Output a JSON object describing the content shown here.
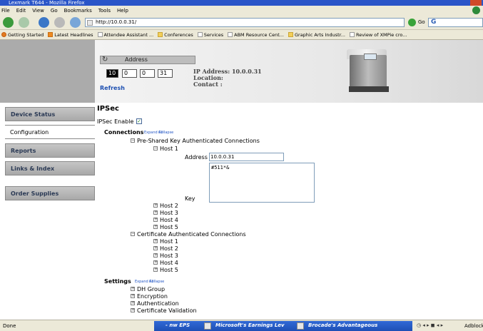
{
  "window": {
    "title": "Lexmark T644 - Mozilla Firefox"
  },
  "menu": [
    "File",
    "Edit",
    "View",
    "Go",
    "Bookmarks",
    "Tools",
    "Help"
  ],
  "toolbar": {
    "url": "http://10.0.0.31/",
    "go_label": "Go"
  },
  "bookmarks": [
    "Getting Started",
    "Latest Headlines",
    "Attendee Assistant ...",
    "Conferences",
    "Services",
    "ABM Resource Cent...",
    "Graphic Arts Industr...",
    "Review of XMPie cro..."
  ],
  "header": {
    "address_label": "Address",
    "ip_octets": [
      "10",
      "0",
      "0",
      "31"
    ],
    "refresh_label": "Refresh",
    "ip_address_line": "IP Address: 10.0.0.31",
    "location_line": "Location:",
    "contact_line": "Contact :"
  },
  "nav": [
    {
      "label": "Device Status"
    },
    {
      "label": "Configuration"
    },
    {
      "label": "Reports"
    },
    {
      "label": "Links & Index"
    },
    {
      "label": "Order Supplies"
    }
  ],
  "main": {
    "title": "IPSec",
    "ipsec_enable_label": "IPSec Enable",
    "ipsec_enabled": true,
    "connections_label": "Connections",
    "expand_all": "Expand All",
    "collapse": "Collapse",
    "psk_label": "Pre-Shared Key Authenticated Connections",
    "host1": "Host 1",
    "address_label": "Address",
    "address_value": "10.0.0.31",
    "key_label": "Key",
    "key_value": "#511*&",
    "psk_hosts": [
      "Host 2",
      "Host 3",
      "Host 4",
      "Host 5"
    ],
    "cert_label": "Certificate Authenticated Connections",
    "cert_hosts": [
      "Host 1",
      "Host 2",
      "Host 3",
      "Host 4",
      "Host 5"
    ],
    "settings_label": "Settings",
    "settings_items": [
      "DH Group",
      "Encryption",
      "Authentication",
      "Certificate Validation"
    ]
  },
  "status": {
    "left": "Done",
    "tasks": [
      "Microsoft's Earnings Lev",
      "Brocade's Advantageous"
    ],
    "task_prefix": "- nw EPS",
    "adblock": "Adblock"
  }
}
